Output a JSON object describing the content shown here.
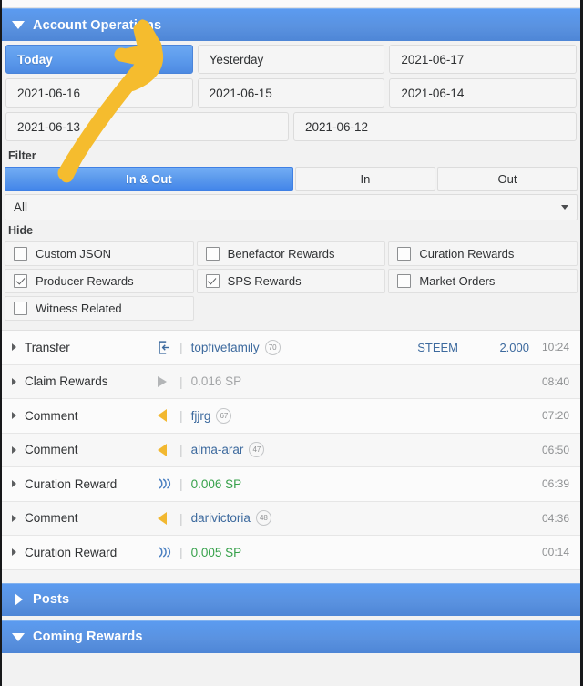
{
  "sections": {
    "account_operations": {
      "title": "Account Operations",
      "caret": "caret-down-icon"
    },
    "posts": {
      "title": "Posts",
      "caret": "caret-right-icon"
    },
    "coming_rewards": {
      "title": "Coming Rewards",
      "caret": "caret-down-icon"
    }
  },
  "date_buttons": [
    {
      "label": "Today",
      "active": true
    },
    {
      "label": "Yesterday",
      "active": false
    },
    {
      "label": "2021-06-17",
      "active": false
    },
    {
      "label": "2021-06-16",
      "active": false
    },
    {
      "label": "2021-06-15",
      "active": false
    },
    {
      "label": "2021-06-14",
      "active": false
    },
    {
      "label": "2021-06-13",
      "active": false
    },
    {
      "label": "2021-06-12",
      "active": false
    }
  ],
  "filter": {
    "label": "Filter",
    "tabs": [
      {
        "label": "In & Out",
        "active": true
      },
      {
        "label": "In",
        "active": false
      },
      {
        "label": "Out",
        "active": false
      }
    ],
    "select": {
      "value": "All",
      "arrow": "chevron-down-icon"
    }
  },
  "hide": {
    "label": "Hide",
    "options": [
      {
        "label": "Custom JSON",
        "checked": false
      },
      {
        "label": "Benefactor Rewards",
        "checked": false
      },
      {
        "label": "Curation Rewards",
        "checked": false
      },
      {
        "label": "Producer Rewards",
        "checked": true
      },
      {
        "label": "SPS Rewards",
        "checked": true
      },
      {
        "label": "Market Orders",
        "checked": false
      },
      {
        "label": "Witness Related",
        "checked": false
      }
    ]
  },
  "operations": [
    {
      "type": "Transfer",
      "icon": "sign-in-icon",
      "user": "topfivefamily",
      "reputation": "70",
      "currency": "STEEM",
      "value": "2.000",
      "time": "10:24"
    },
    {
      "type": "Claim Rewards",
      "icon": "play-triangle-icon",
      "amount": "0.016 SP",
      "amount_style": "gray",
      "time": "08:40"
    },
    {
      "type": "Comment",
      "icon": "reply-triangle-icon",
      "user": "fjjrg",
      "reputation": "67",
      "time": "07:20"
    },
    {
      "type": "Comment",
      "icon": "reply-triangle-icon",
      "user": "alma-arar",
      "reputation": "47",
      "time": "06:50"
    },
    {
      "type": "Curation Reward",
      "icon": "steem-logo-icon",
      "amount": "0.006 SP",
      "amount_style": "green",
      "time": "06:39"
    },
    {
      "type": "Comment",
      "icon": "reply-triangle-icon",
      "user": "darivictoria",
      "reputation": "48",
      "time": "04:36"
    },
    {
      "type": "Curation Reward",
      "icon": "steem-logo-icon",
      "amount": "0.005 SP",
      "amount_style": "green",
      "time": "00:14"
    }
  ],
  "annotation": {
    "name": "yellow-arrow-annotation",
    "color": "#f5bc2e"
  },
  "colors": {
    "header_blue": "#5a92e0",
    "active_blue": "#4d8ae2",
    "link_blue": "#3d6a9e",
    "green": "#36a14a",
    "yellow": "#f2b830",
    "page_bg": "#f2f2f2"
  }
}
